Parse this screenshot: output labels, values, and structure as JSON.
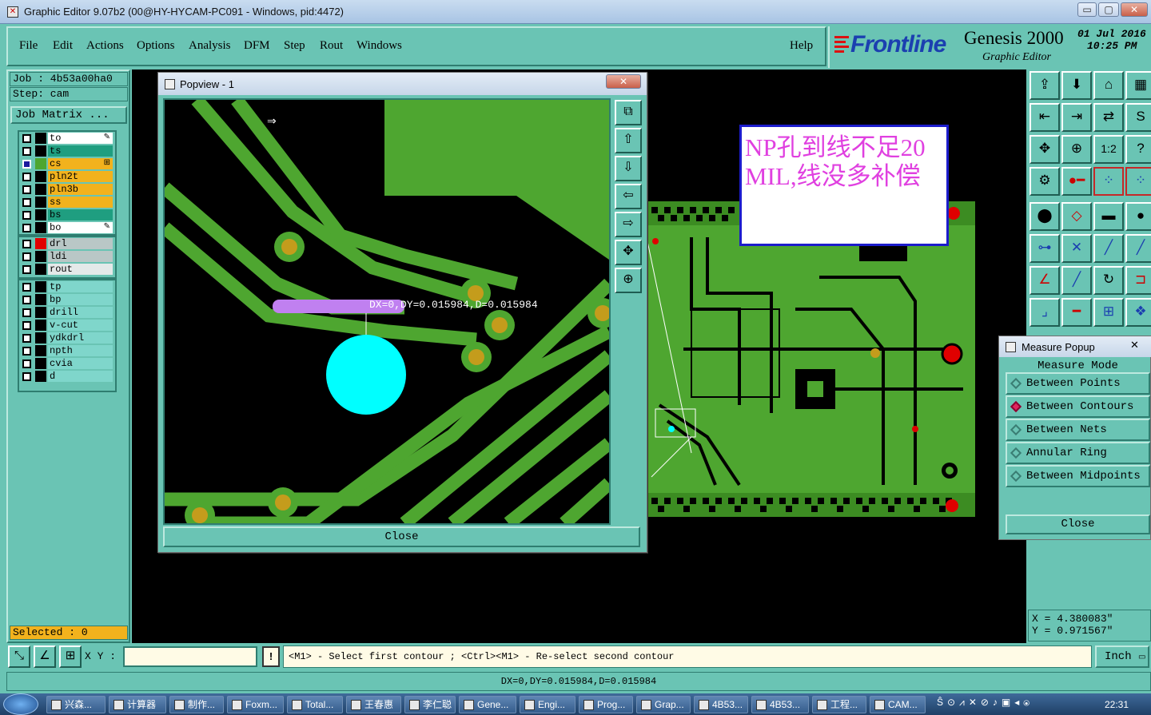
{
  "window": {
    "title": "Graphic Editor 9.07b2 (00@HY-HYCAM-PC091 - Windows, pid:4472)",
    "controls": [
      "▭",
      "▢",
      "✕"
    ]
  },
  "menu": {
    "items": [
      "File",
      "Edit",
      "Actions",
      "Options",
      "Analysis",
      "DFM",
      "Step",
      "Rout",
      "Windows"
    ],
    "help": "Help"
  },
  "brand": {
    "logo": "Frontline",
    "product": "Genesis 2000",
    "subtitle": "Graphic Editor",
    "date": "01 Jul 2016",
    "time": "10:25 PM"
  },
  "job": {
    "job_line": "Job : 4b53a00ha0",
    "step_line": "Step: cam",
    "matrix_button": "Job Matrix ..."
  },
  "layers_group1": [
    {
      "name": "to",
      "color": "#ffffff",
      "swatch": "#000000",
      "flag": "✎"
    },
    {
      "name": "ts",
      "color": "#1f9e80",
      "swatch": "#000000",
      "flag": ""
    },
    {
      "name": "cs",
      "color": "#f2b21d",
      "swatch": "#4ea630",
      "flag": "⊞",
      "selected": true
    },
    {
      "name": "pln2t",
      "color": "#f2b21d",
      "swatch": "#000000",
      "flag": ""
    },
    {
      "name": "pln3b",
      "color": "#f2b21d",
      "swatch": "#000000",
      "flag": ""
    },
    {
      "name": "ss",
      "color": "#f2b21d",
      "swatch": "#000000",
      "flag": ""
    },
    {
      "name": "bs",
      "color": "#1f9e80",
      "swatch": "#000000",
      "flag": ""
    },
    {
      "name": "bo",
      "color": "#ffffff",
      "swatch": "#000000",
      "flag": "✎"
    }
  ],
  "layers_group2": [
    {
      "name": "drl",
      "color": "#b9c7c6",
      "swatch": "#e00000"
    },
    {
      "name": "ldi",
      "color": "#b9c7c6",
      "swatch": "#000000"
    },
    {
      "name": "rout",
      "color": "#e4e9e9",
      "swatch": "#000000"
    }
  ],
  "layers_group3": [
    {
      "name": "tp",
      "color": "#7fd6cb"
    },
    {
      "name": "bp",
      "color": "#7fd6cb"
    },
    {
      "name": "drill",
      "color": "#7fd6cb"
    },
    {
      "name": "v-cut",
      "color": "#7fd6cb"
    },
    {
      "name": "ydkdrl",
      "color": "#7fd6cb"
    },
    {
      "name": "npth",
      "color": "#7fd6cb"
    },
    {
      "name": "cvia",
      "color": "#7fd6cb"
    },
    {
      "name": "d",
      "color": "#7fd6cb"
    }
  ],
  "selected": "Selected : 0",
  "popview": {
    "title": "Popview - 1",
    "measure_label": "DX=0,DY=0.015984,D=0.015984",
    "close": "Close"
  },
  "annotation": {
    "text": "NP孔到线不足20MIL,线没多补偿"
  },
  "measure_popup": {
    "title": "Measure Popup",
    "mode_header": "Measure Mode",
    "options": [
      "Between Points",
      "Between Contours",
      "Between Nets",
      "Annular Ring",
      "Between Midpoints"
    ],
    "selected_option": "Between Contours",
    "close": "Close"
  },
  "coords": {
    "x": "X = 4.380083\"",
    "y": "Y = 0.971567\""
  },
  "command": {
    "xy_label": "X Y :",
    "xy_value": "",
    "prompt": "<M1> - Select first contour ; <Ctrl><M1> - Re-select second contour",
    "units": "Inch"
  },
  "status": "DX=0,DY=0.015984,D=0.015984",
  "taskbar": {
    "items": [
      "兴森...",
      "计算器",
      "制作...",
      "Foxm...",
      "Total...",
      "王春惠",
      "李仁聪",
      "Gene...",
      "Engi...",
      "Prog...",
      "Grap...",
      "4B53...",
      "4B53...",
      "工程...",
      "CAM..."
    ],
    "clock": "22:31"
  },
  "colors": {
    "panel": "#6ac4b4",
    "copper": "#4ea630",
    "pad_ring": "#c49c1c",
    "npth": "#00ffff",
    "measure_bar": "#c080f0",
    "annotation_text": "#e040e0"
  }
}
